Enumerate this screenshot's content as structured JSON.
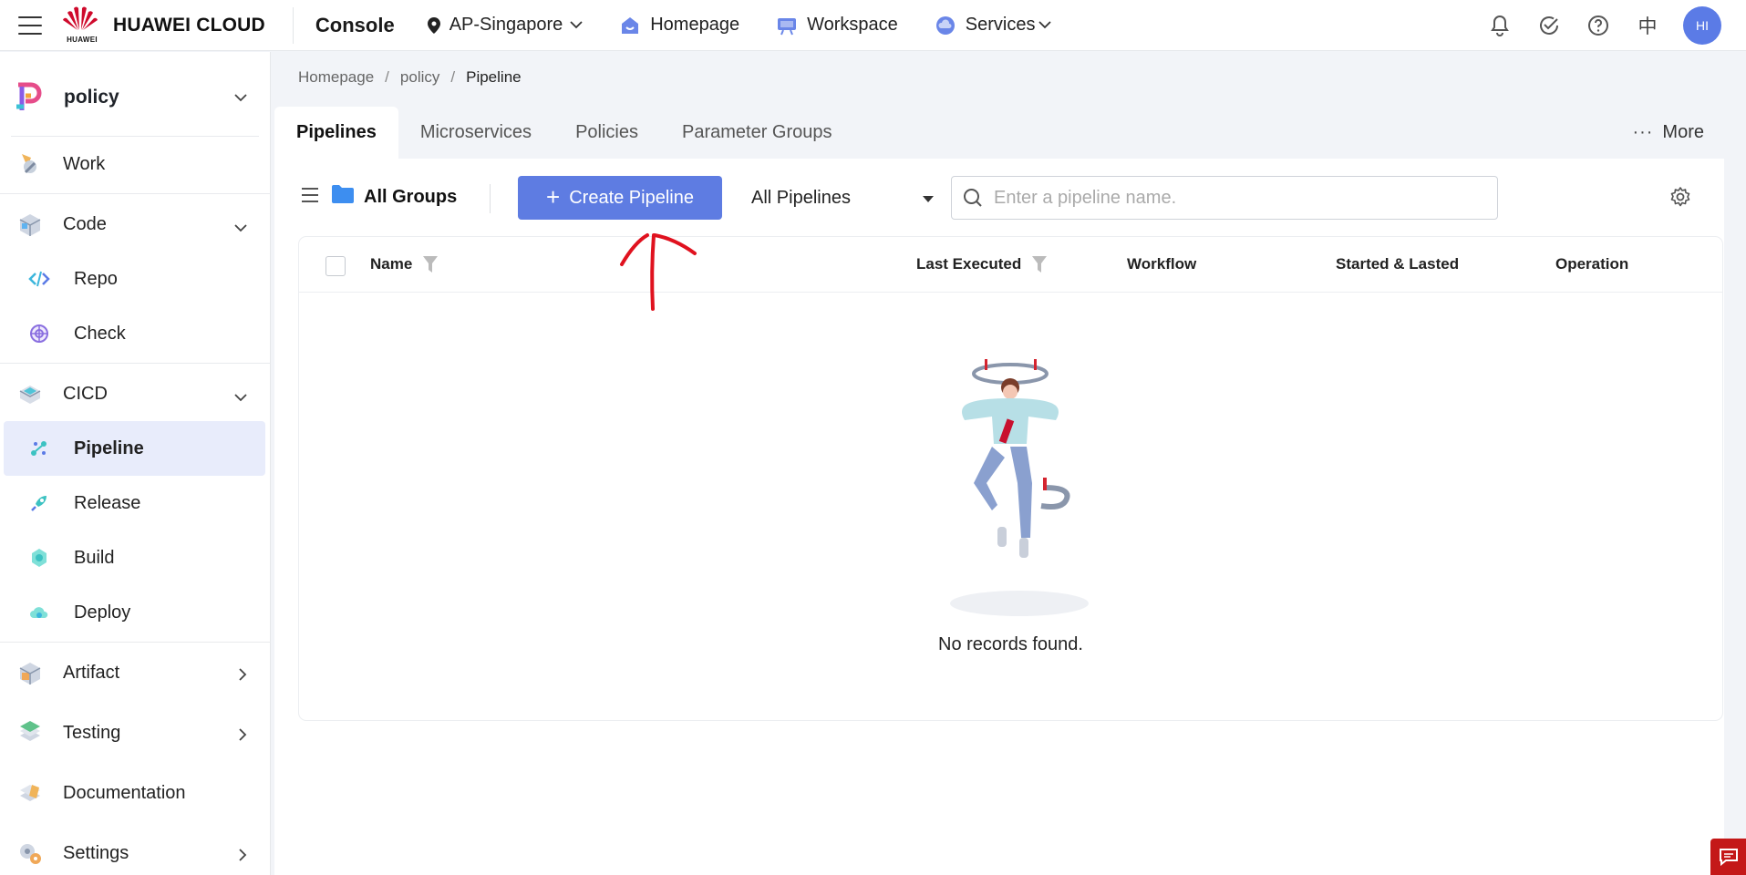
{
  "header": {
    "brand": "HUAWEI CLOUD",
    "brand_sub": "HUAWEI",
    "console": "Console",
    "region": "AP-Singapore",
    "homepage": "Homepage",
    "workspace": "Workspace",
    "services": "Services",
    "language": "中",
    "avatar": "HI"
  },
  "sidebar": {
    "project": "policy",
    "items": [
      {
        "label": "Work",
        "icon": "work-icon"
      },
      {
        "label": "Code",
        "icon": "code-icon",
        "expanded": true
      },
      {
        "label": "Repo",
        "icon": "repo-icon"
      },
      {
        "label": "Check",
        "icon": "check-icon"
      },
      {
        "label": "CICD",
        "icon": "cicd-icon",
        "expanded": true
      },
      {
        "label": "Pipeline",
        "icon": "pipeline-icon",
        "active": true
      },
      {
        "label": "Release",
        "icon": "release-icon"
      },
      {
        "label": "Build",
        "icon": "build-icon"
      },
      {
        "label": "Deploy",
        "icon": "deploy-icon"
      },
      {
        "label": "Artifact",
        "icon": "artifact-icon"
      },
      {
        "label": "Testing",
        "icon": "testing-icon"
      },
      {
        "label": "Documentation",
        "icon": "documentation-icon"
      },
      {
        "label": "Settings",
        "icon": "settings-icon"
      }
    ]
  },
  "breadcrumb": [
    "Homepage",
    "policy",
    "Pipeline"
  ],
  "tabs": [
    "Pipelines",
    "Microservices",
    "Policies",
    "Parameter Groups"
  ],
  "more_label": "More",
  "toolbar": {
    "groups": "All Groups",
    "create": "Create Pipeline",
    "filter": "All Pipelines",
    "search_placeholder": "Enter a pipeline name."
  },
  "table": {
    "columns": [
      "Name",
      "Last Executed",
      "Workflow",
      "Started & Lasted",
      "Operation"
    ],
    "empty": "No records found."
  },
  "colors": {
    "primary": "#5e7ce2",
    "active_bg": "#e8ecfb",
    "annotation": "#e0121f"
  }
}
